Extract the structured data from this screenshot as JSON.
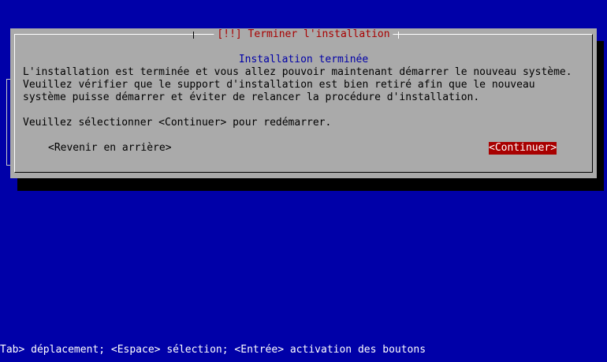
{
  "dialog": {
    "title": "[!!] Terminer l'installation",
    "heading": "Installation terminée",
    "lines": [
      "L'installation est terminée et vous allez pouvoir maintenant démarrer le nouveau système.",
      "Veuillez vérifier que le support d'installation est bien retiré afin que le nouveau",
      "système puisse démarrer et éviter de relancer la procédure d'installation."
    ],
    "instruction": "Veuillez sélectionner <Continuer> pour redémarrer.",
    "buttons": {
      "back": "<Revenir en arrière>",
      "continue": "<Continuer>"
    }
  },
  "status_bar": "Tab> déplacement; <Espace> sélection; <Entrée> activation des boutons",
  "colors": {
    "background": "#0000a8",
    "dialog": "#aaaaaa",
    "title": "#a80000",
    "heading": "#0000a8",
    "selected_button": "#a80000"
  }
}
